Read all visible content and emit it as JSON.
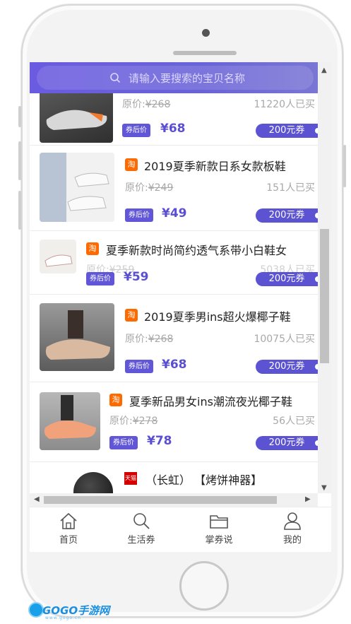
{
  "search": {
    "placeholder": "请输入要搜索的宝贝名称"
  },
  "labels": {
    "original_prefix": "原价:",
    "after_coupon": "券后价"
  },
  "products": [
    {
      "title": "",
      "original_price": "¥268",
      "sold": "11220人已买",
      "price": "¥68",
      "coupon": "200元券",
      "platform": "taobao"
    },
    {
      "title": "2019夏季新款日系女款板鞋",
      "original_price": "¥249",
      "sold": "151人已买",
      "price": "¥49",
      "coupon": "200元券",
      "platform": "taobao",
      "platform_badge": "淘"
    },
    {
      "title": "夏季新款时尚简约透气系带小白鞋女",
      "original_price": "¥259",
      "sold": "5038人已买",
      "price": "¥59",
      "coupon": "200元券",
      "platform": "taobao",
      "platform_badge": "淘"
    },
    {
      "title": "2019夏季男ins超火爆椰子鞋",
      "original_price": "¥268",
      "sold": "10075人已买",
      "price": "¥68",
      "coupon": "200元券",
      "platform": "taobao",
      "platform_badge": "淘"
    },
    {
      "title": "夏季新品男女ins潮流夜光椰子鞋",
      "original_price": "¥278",
      "sold": "56人已买",
      "price": "¥78",
      "coupon": "200元券",
      "platform": "taobao",
      "platform_badge": "淘"
    },
    {
      "title": "（长虹） 【烤饼神器】",
      "platform": "tmall",
      "platform_badge": "天猫"
    }
  ],
  "tabs": [
    {
      "label": "首页",
      "icon": "home-icon"
    },
    {
      "label": "生活券",
      "icon": "search-icon"
    },
    {
      "label": "掌券说",
      "icon": "folder-icon"
    },
    {
      "label": "我的",
      "icon": "user-icon"
    }
  ],
  "watermark": {
    "text": "GOGO手游网",
    "sub": "www.gogo.cn"
  },
  "colors": {
    "accent": "#5b53d2",
    "search_bar": "#6a5be0",
    "taobao_badge": "#ff6a00",
    "tmall_badge": "#d40000"
  }
}
